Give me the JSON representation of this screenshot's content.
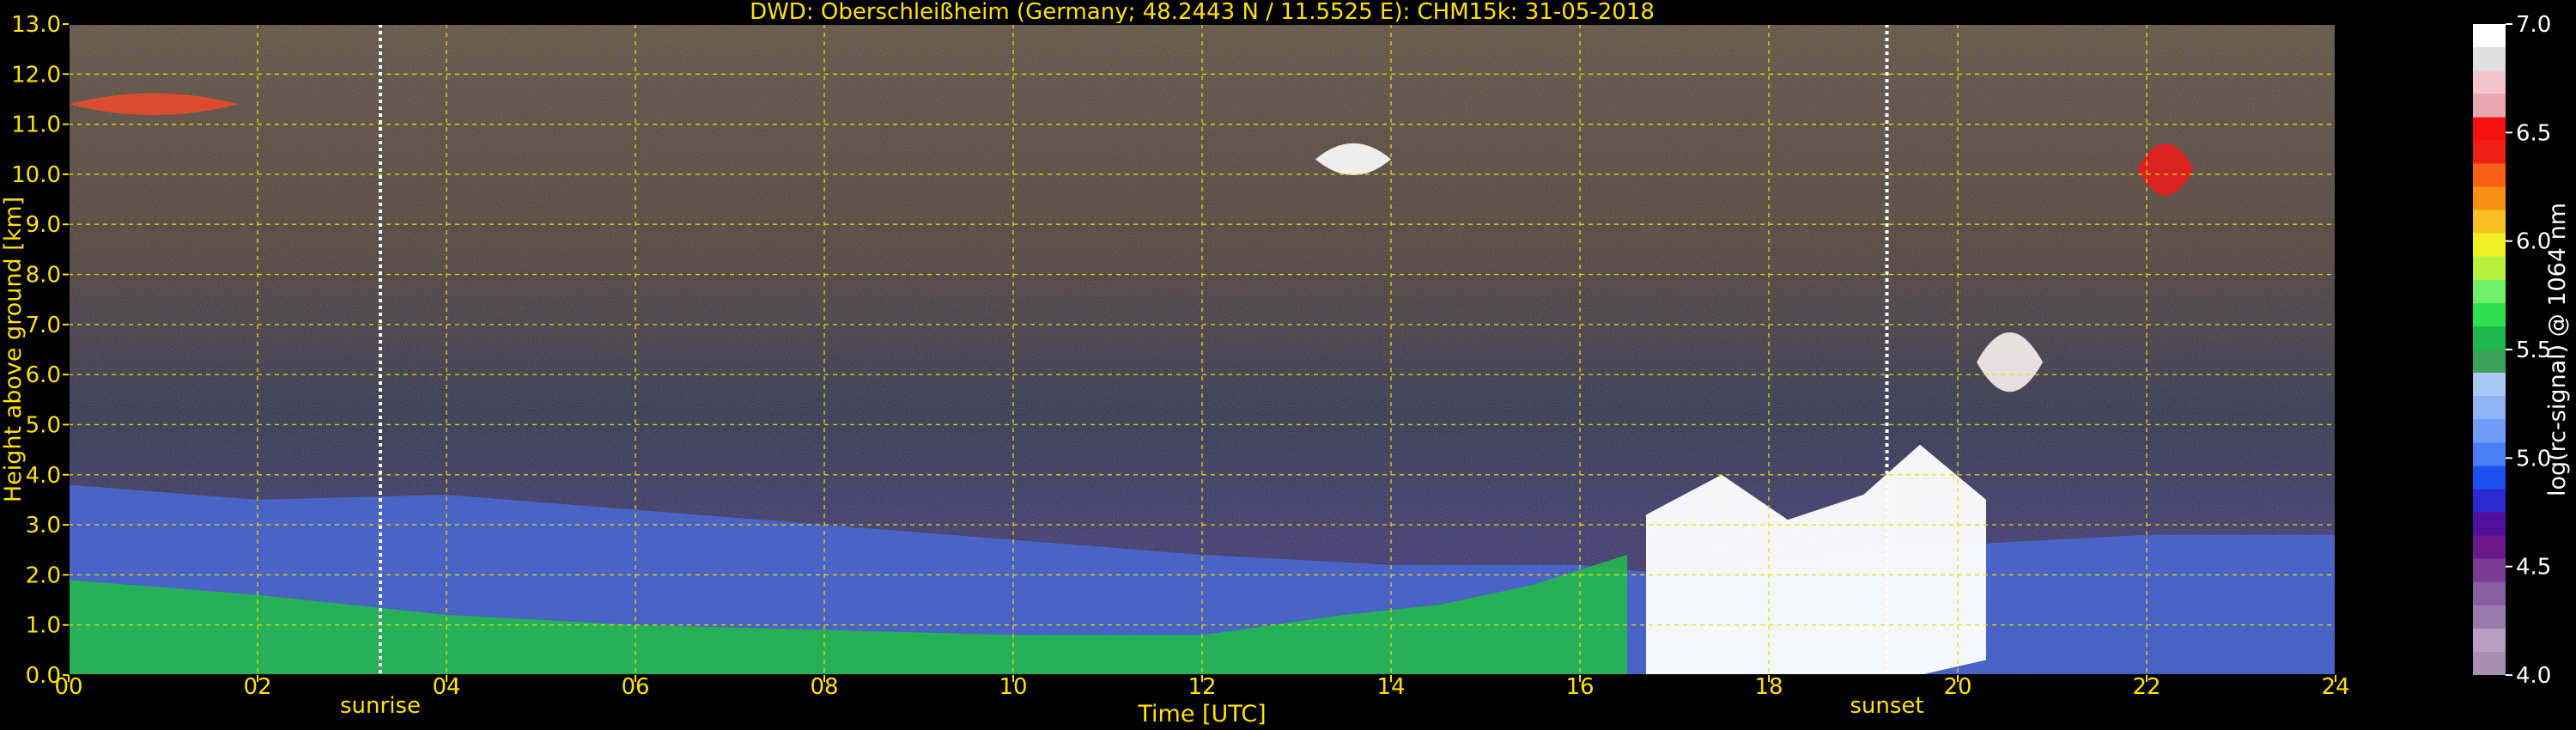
{
  "chart_data": {
    "type": "heatmap",
    "title": "DWD: Oberschleißheim (Germany; 48.2443 N / 11.5525 E):    CHM15k: 31-05-2018",
    "xlabel": "Time [UTC]",
    "ylabel": "Height above ground [km]",
    "xlim": [
      0,
      24
    ],
    "ylim": [
      0,
      13
    ],
    "x_ticks": [
      "00",
      "02",
      "04",
      "06",
      "08",
      "10",
      "12",
      "14",
      "16",
      "18",
      "20",
      "22",
      "24"
    ],
    "y_ticks": [
      "0.0",
      "1.0",
      "2.0",
      "3.0",
      "4.0",
      "5.0",
      "6.0",
      "7.0",
      "8.0",
      "9.0",
      "10.0",
      "11.0",
      "12.0",
      "13.0"
    ],
    "grid": true,
    "markers": [
      {
        "label": "sunrise",
        "time": 3.3
      },
      {
        "label": "sunset",
        "time": 19.25
      }
    ],
    "colorbar": {
      "label": "log(rc-signal) @ 1064 nm",
      "range": [
        4.0,
        7.0
      ],
      "ticks": [
        "4.0",
        "4.5",
        "5.0",
        "5.5",
        "6.0",
        "6.5",
        "7.0"
      ],
      "colors": [
        "#a98fb3",
        "#b89ec2",
        "#9a7cab",
        "#8a5ca0",
        "#7a3a94",
        "#6a1a8a",
        "#50109a",
        "#2a2ad0",
        "#1a50f0",
        "#4a7ef8",
        "#6e9cf8",
        "#90b4f6",
        "#aac8f6",
        "#3aa05a",
        "#1db84a",
        "#2ee04e",
        "#6ef06a",
        "#b8f040",
        "#f0f020",
        "#f8c020",
        "#f89018",
        "#f86018",
        "#f02018",
        "#f81010",
        "#e8a8b0",
        "#f4c4cc",
        "#e0e0e0",
        "#ffffff"
      ]
    },
    "layers": [
      {
        "name": "boundary-layer-green",
        "x": [
          0,
          2,
          4,
          6,
          8,
          10,
          12,
          13.5,
          14.5,
          15.5,
          16.5
        ],
        "top": [
          1.9,
          1.6,
          1.2,
          1.0,
          0.9,
          0.8,
          0.8,
          1.2,
          1.4,
          1.8,
          2.4
        ]
      },
      {
        "name": "residual-blue",
        "x": [
          0,
          2,
          4,
          6,
          8,
          10,
          12,
          14,
          16,
          17,
          20,
          22,
          24
        ],
        "top": [
          3.8,
          3.5,
          3.6,
          3.3,
          3.0,
          2.7,
          2.4,
          2.2,
          2.2,
          2.0,
          2.6,
          2.8,
          2.8
        ]
      },
      {
        "name": "convective-clouds",
        "x": [
          16.7,
          17.5,
          18.2,
          19.0,
          19.6,
          20.3
        ],
        "base": [
          0.0,
          0.0,
          0.0,
          0.0,
          0.0,
          0.3
        ],
        "top": [
          3.2,
          4.0,
          3.1,
          3.6,
          4.6,
          3.5
        ]
      },
      {
        "name": "cirrus-early",
        "x": [
          0.0,
          1.8
        ],
        "base": 11.1,
        "top": 11.7
      },
      {
        "name": "cirrus-mid",
        "x": [
          13.2,
          14.0
        ],
        "base": 9.8,
        "top": 10.8
      },
      {
        "name": "cirrus-late",
        "x": [
          21.9,
          22.5
        ],
        "base": 9.2,
        "top": 11.0
      },
      {
        "name": "cloud-7km",
        "x": [
          20.2,
          20.9
        ],
        "base": 5.2,
        "top": 7.3
      }
    ]
  }
}
